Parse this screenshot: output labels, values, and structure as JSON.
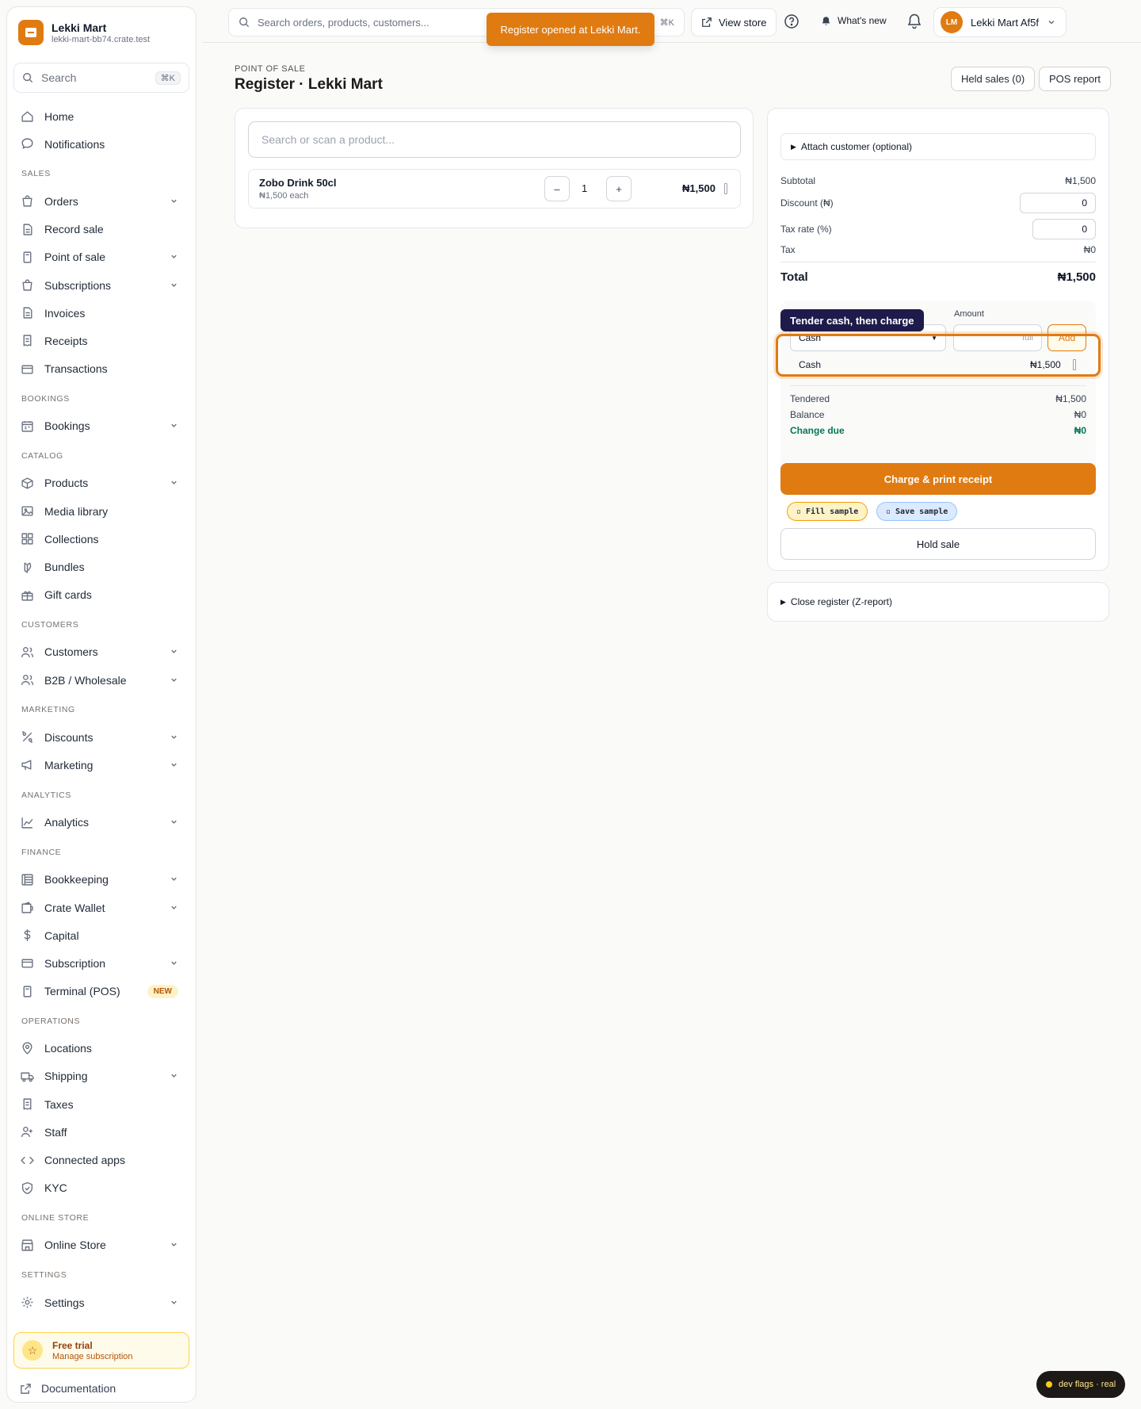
{
  "brand": {
    "name": "Lekki Mart",
    "domain": "lekki-mart-bb74.crate.test"
  },
  "sidebar": {
    "search": {
      "label": "Search",
      "shortcut": "⌘K"
    },
    "top_items": [
      {
        "label": "Home",
        "icon": "home-icon"
      },
      {
        "label": "Notifications",
        "icon": "chat-bubble-icon"
      }
    ],
    "sections": [
      {
        "title": "SALES",
        "items": [
          {
            "label": "Orders",
            "icon": "shopping-bag-icon",
            "expandable": true
          },
          {
            "label": "Record sale",
            "icon": "document-icon",
            "expandable": false
          },
          {
            "label": "Point of sale",
            "icon": "terminal-icon",
            "expandable": true
          },
          {
            "label": "Subscriptions",
            "icon": "shopping-bag-icon",
            "expandable": true
          },
          {
            "label": "Invoices",
            "icon": "document-icon",
            "expandable": false
          },
          {
            "label": "Receipts",
            "icon": "receipt-icon",
            "expandable": false
          },
          {
            "label": "Transactions",
            "icon": "card-icon",
            "expandable": false
          }
        ]
      },
      {
        "title": "BOOKINGS",
        "items": [
          {
            "label": "Bookings",
            "icon": "calendar-icon",
            "expandable": true
          }
        ]
      },
      {
        "title": "CATALOG",
        "items": [
          {
            "label": "Products",
            "icon": "cube-icon",
            "expandable": true
          },
          {
            "label": "Media library",
            "icon": "image-icon",
            "expandable": false
          },
          {
            "label": "Collections",
            "icon": "grid-icon",
            "expandable": false
          },
          {
            "label": "Bundles",
            "icon": "bundle-icon",
            "expandable": false
          },
          {
            "label": "Gift cards",
            "icon": "gift-icon",
            "expandable": false
          }
        ]
      },
      {
        "title": "CUSTOMERS",
        "items": [
          {
            "label": "Customers",
            "icon": "users-icon",
            "expandable": true
          },
          {
            "label": "B2B / Wholesale",
            "icon": "users-icon",
            "expandable": true
          }
        ]
      },
      {
        "title": "MARKETING",
        "items": [
          {
            "label": "Discounts",
            "icon": "percent-icon",
            "expandable": true
          },
          {
            "label": "Marketing",
            "icon": "megaphone-icon",
            "expandable": true
          }
        ]
      },
      {
        "title": "ANALYTICS",
        "items": [
          {
            "label": "Analytics",
            "icon": "chart-line-icon",
            "expandable": true
          }
        ]
      },
      {
        "title": "FINANCE",
        "items": [
          {
            "label": "Bookkeeping",
            "icon": "ledger-icon",
            "expandable": true
          },
          {
            "label": "Crate Wallet",
            "icon": "wallet-icon",
            "expandable": true
          },
          {
            "label": "Capital",
            "icon": "dollar-icon",
            "expandable": false
          },
          {
            "label": "Subscription",
            "icon": "card-icon",
            "expandable": true
          },
          {
            "label": "Terminal (POS)",
            "icon": "terminal-icon",
            "expandable": false,
            "badge": "NEW"
          }
        ]
      },
      {
        "title": "OPERATIONS",
        "items": [
          {
            "label": "Locations",
            "icon": "map-pin-icon",
            "expandable": false
          },
          {
            "label": "Shipping",
            "icon": "truck-icon",
            "expandable": true
          },
          {
            "label": "Taxes",
            "icon": "receipt-icon",
            "expandable": false
          },
          {
            "label": "Staff",
            "icon": "user-plus-icon",
            "expandable": false
          },
          {
            "label": "Connected apps",
            "icon": "code-icon",
            "expandable": false
          },
          {
            "label": "KYC",
            "icon": "shield-icon",
            "expandable": false
          }
        ]
      },
      {
        "title": "ONLINE STORE",
        "items": [
          {
            "label": "Online Store",
            "icon": "storefront-icon",
            "expandable": true
          }
        ]
      },
      {
        "title": "SETTINGS",
        "items": [
          {
            "label": "Settings",
            "icon": "gear-icon",
            "expandable": true
          }
        ]
      }
    ],
    "trial": {
      "title": "Free trial",
      "subtitle": "Manage subscription"
    },
    "docs_label": "Documentation"
  },
  "topbar": {
    "search_placeholder": "Search orders, products, customers...",
    "search_shortcut": "⌘K",
    "view_store": "View store",
    "whats_new": "What's new",
    "account_initials": "LM",
    "account_name": "Lekki Mart Af5f"
  },
  "toast": "Register opened at Lekki Mart.",
  "page": {
    "eyebrow": "POINT OF SALE",
    "title": "Register · Lekki Mart",
    "held_sales": "Held sales (0)",
    "pos_report": "POS report"
  },
  "cart": {
    "scan_placeholder": "Search or scan a product...",
    "items": [
      {
        "name": "Zobo Drink 50cl",
        "unit_price": "₦1,500 each",
        "qty": "1",
        "total": "₦1,500",
        "minus": "–",
        "plus": "+"
      }
    ]
  },
  "payment": {
    "attach_customer": "Attach customer (optional)",
    "subtotal_label": "Subtotal",
    "subtotal": "₦1,500",
    "discount_label": "Discount (₦)",
    "discount": "0",
    "tax_rate_label": "Tax rate (%)",
    "tax_rate": "0",
    "tax_label": "Tax",
    "tax": "₦0",
    "total_label": "Total",
    "total": "₦1,500",
    "amount_label": "Amount",
    "method_selected": "Cash",
    "amount_placeholder": "full",
    "add_label": "Add",
    "tenders": [
      {
        "method": "Cash",
        "amount": "₦1,500"
      }
    ],
    "tendered_label": "Tendered",
    "tendered": "₦1,500",
    "balance_label": "Balance",
    "balance": "₦0",
    "change_label": "Change due",
    "change": "₦0",
    "charge_label": "Charge & print receipt",
    "fill_sample": "▫ Fill sample",
    "save_sample": "▫ Save sample",
    "hold_label": "Hold sale"
  },
  "tour_tip": "Tender cash, then charge",
  "close_register": "Close register (Z-report)",
  "dev_flags": "dev flags · real",
  "colors": {
    "accent": "#e07b12",
    "success": "#047857",
    "tooltip": "#1e1b4b"
  }
}
